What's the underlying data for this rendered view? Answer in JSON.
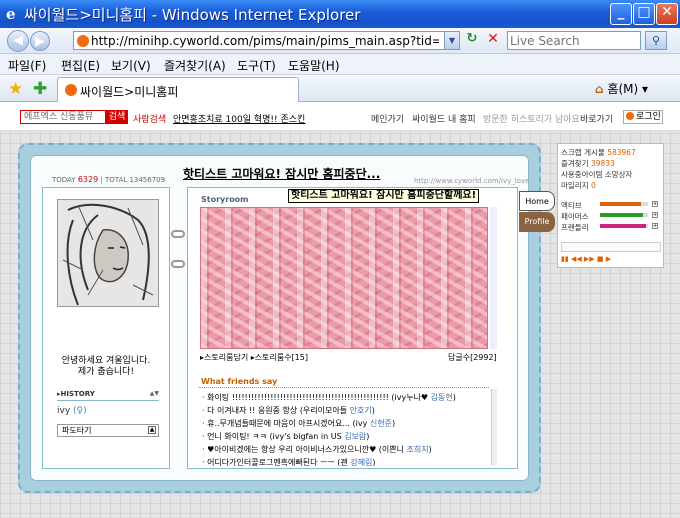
{
  "window": {
    "title": "싸이월드>미니홈피 - Windows Internet Explorer"
  },
  "address": {
    "url": "http://minihp.cyworld.com/pims/main/pims_main.asp?tid=44808634",
    "search_placeholder": "Live Search"
  },
  "menu": [
    "파일(F)",
    "편집(E)",
    "보기(V)",
    "즐겨찾기(A)",
    "도구(T)",
    "도움말(H)"
  ],
  "tab": {
    "label": "싸이월드>미니홈피",
    "home_label": "홈(M)"
  },
  "cybar": {
    "search_value": "에프엑스 신동품뮤",
    "search_button": "검색",
    "people_search": "사람검색",
    "promo": "안면홍조치료 100일 혁명!! 존스킨",
    "links": [
      "메인가기",
      "싸이월드 내 홈피",
      "방문한 히스토리가 남아요",
      "바로가기"
    ],
    "login": "로그인"
  },
  "counter": {
    "today_label": "TODAY",
    "today": "6329",
    "total_label": "TOTAL",
    "total": "13456709"
  },
  "profile": {
    "intro_line1": "안녕하세요 겨울입니다.",
    "intro_line2": "제가 춥습니다!",
    "history_label": "HISTORY",
    "history_arrows": "▲▼",
    "name": "ivy",
    "name_sub": "(♀)",
    "pado_label": "파도타기",
    "pado_arrow": "▲"
  },
  "main": {
    "title": "핫티스트 고마워요! 잠시만 홈피중단...",
    "url": "http://www.cyworld.com/ivy_love",
    "tooltip": "핫티스트 고마워요! 잠시만 홈피중단할께요!",
    "storyroom_label": "Storyroom",
    "story_link1": "▸스토리룸담기",
    "story_link2": "▸스토리룸수[15]",
    "comment_count": "답글수[2992]",
    "friends_label": "What friends say",
    "friends": [
      {
        "text": "· 화이팅 !!!!!!!!!!!!!!!!!!!!!!!!!!!!!!!!!!!!!!!!!!!!!!!!! (ivy누나♥ ",
        "name": "김동현",
        "tail": ")"
      },
      {
        "text": "· 다 이겨내자 !! 응원중 항상 (우리이모아들 ",
        "name": "안호기",
        "tail": ")"
      },
      {
        "text": "· 휴..무개념들때문에 마음이 아프시겠어요... (ivy ",
        "name": "신현준",
        "tail": ")"
      },
      {
        "text": "· 언니 화이팅! ㅋㅋ (ivy's bigfan in US ",
        "name": "김보람",
        "tail": ")"
      },
      {
        "text": "· ♥아이비겠에는 항상 우리 아이비너스가있으니깐♥ (이쁜니 ",
        "name": "조희지",
        "tail": ")"
      },
      {
        "text": "· 어디다가인터콜로그멘흑에빠된다 ㅡㅡ (괜 ",
        "name": "강혜림",
        "tail": ")"
      }
    ]
  },
  "side_tabs": {
    "home": "Home",
    "profile": "Profile"
  },
  "right_panel": {
    "scrap_label": "스크랩 게시물",
    "scrap": "583967",
    "fav_label": "즐겨찾기",
    "fav": "39833",
    "items_label": "사용중아이템",
    "items_link": "소망상자",
    "mileage_label": "마일리지",
    "mileage": "0",
    "bars": [
      {
        "label": "액티브",
        "value": 0.85,
        "color": "#e06010"
      },
      {
        "label": "패이머스",
        "value": 0.9,
        "color": "#2a9a2a"
      },
      {
        "label": "프랜들리",
        "value": 0.95,
        "color": "#d02080"
      }
    ],
    "player_ctrl": "▮▮ ◀◀ ▶▶ ■ ▶"
  }
}
